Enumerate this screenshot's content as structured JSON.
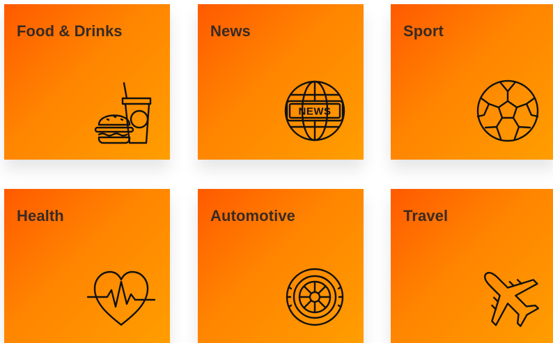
{
  "categories": [
    {
      "title": "Food & Drinks",
      "icon": "burger-and-drink-icon"
    },
    {
      "title": "News",
      "icon": "news-globe-icon",
      "icon_text": "NEWS"
    },
    {
      "title": "Sport",
      "icon": "soccer-ball-icon"
    },
    {
      "title": "Health",
      "icon": "heartbeat-icon"
    },
    {
      "title": "Automotive",
      "icon": "car-wheel-icon"
    },
    {
      "title": "Travel",
      "icon": "airplane-icon"
    }
  ],
  "colors": {
    "gradient_start": "#ff5a00",
    "gradient_end": "#ff9e00",
    "title_color": "#3a2a22",
    "icon_stroke": "#111111"
  }
}
